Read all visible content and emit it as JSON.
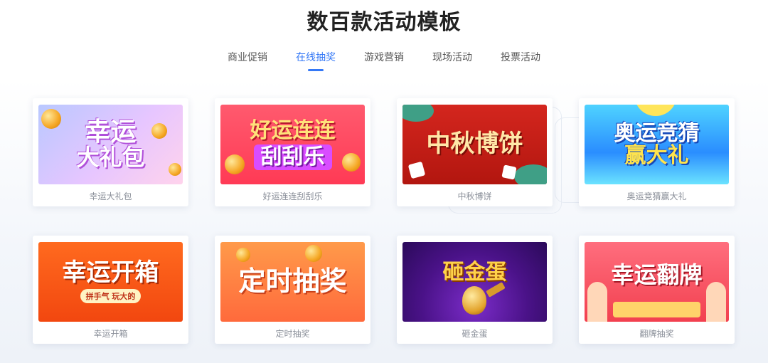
{
  "page_title": "数百款活动模板",
  "tabs": [
    {
      "label": "商业促销",
      "active": false
    },
    {
      "label": "在线抽奖",
      "active": true
    },
    {
      "label": "游戏营销",
      "active": false
    },
    {
      "label": "现场活动",
      "active": false
    },
    {
      "label": "投票活动",
      "active": false
    }
  ],
  "cards": [
    {
      "label": "幸运大礼包",
      "banner_line1": "幸运",
      "banner_line2": "大礼包"
    },
    {
      "label": "好运连连刮刮乐",
      "banner_line1": "好运连连",
      "banner_line2": "刮刮乐"
    },
    {
      "label": "中秋博饼",
      "banner_line1": "中秋博饼",
      "banner_line2": ""
    },
    {
      "label": "奥运竞猜赢大礼",
      "banner_line1": "奥运竞猜",
      "banner_line2": "赢大礼"
    },
    {
      "label": "幸运开箱",
      "banner_line1": "幸运开箱",
      "banner_line2": "拼手气  玩大的"
    },
    {
      "label": "定时抽奖",
      "banner_line1": "定时抽奖",
      "banner_line2": ""
    },
    {
      "label": "砸金蛋",
      "banner_line1": "砸金蛋",
      "banner_line2": ""
    },
    {
      "label": "翻牌抽奖",
      "banner_line1": "幸运翻牌",
      "banner_line2": ""
    }
  ],
  "colors": {
    "accent": "#3478f6",
    "tab_text": "#555555",
    "card_label": "#8a8f99"
  }
}
